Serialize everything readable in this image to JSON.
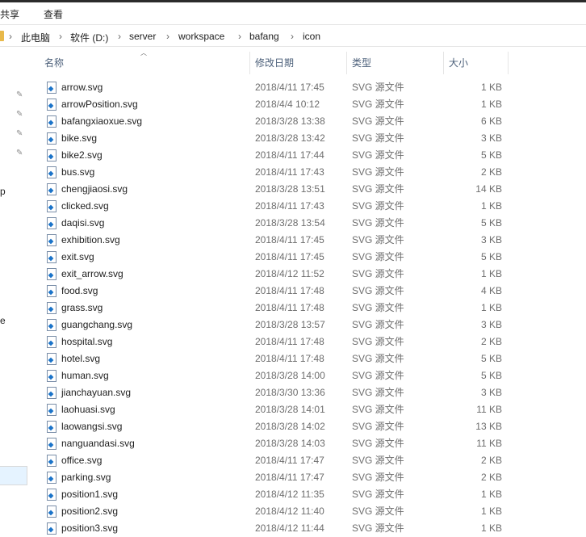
{
  "ribbon": {
    "tabs": [
      "共享",
      "查看"
    ]
  },
  "address": {
    "crumbs": [
      "此电脑",
      "软件 (D:)",
      "server",
      "workspace",
      "bafang",
      "icon"
    ]
  },
  "nav": {
    "fragments": [
      "p",
      "e"
    ]
  },
  "columns": {
    "name": "名称",
    "date": "修改日期",
    "type": "类型",
    "size": "大小"
  },
  "files": [
    {
      "name": "arrow.svg",
      "date": "2018/4/11 17:45",
      "type": "SVG 源文件",
      "size": "1 KB"
    },
    {
      "name": "arrowPosition.svg",
      "date": "2018/4/4 10:12",
      "type": "SVG 源文件",
      "size": "1 KB"
    },
    {
      "name": "bafangxiaoxue.svg",
      "date": "2018/3/28 13:38",
      "type": "SVG 源文件",
      "size": "6 KB"
    },
    {
      "name": "bike.svg",
      "date": "2018/3/28 13:42",
      "type": "SVG 源文件",
      "size": "3 KB"
    },
    {
      "name": "bike2.svg",
      "date": "2018/4/11 17:44",
      "type": "SVG 源文件",
      "size": "5 KB"
    },
    {
      "name": "bus.svg",
      "date": "2018/4/11 17:43",
      "type": "SVG 源文件",
      "size": "2 KB"
    },
    {
      "name": "chengjiaosi.svg",
      "date": "2018/3/28 13:51",
      "type": "SVG 源文件",
      "size": "14 KB"
    },
    {
      "name": "clicked.svg",
      "date": "2018/4/11 17:43",
      "type": "SVG 源文件",
      "size": "1 KB"
    },
    {
      "name": "daqisi.svg",
      "date": "2018/3/28 13:54",
      "type": "SVG 源文件",
      "size": "5 KB"
    },
    {
      "name": "exhibition.svg",
      "date": "2018/4/11 17:45",
      "type": "SVG 源文件",
      "size": "3 KB"
    },
    {
      "name": "exit.svg",
      "date": "2018/4/11 17:45",
      "type": "SVG 源文件",
      "size": "5 KB"
    },
    {
      "name": "exit_arrow.svg",
      "date": "2018/4/12 11:52",
      "type": "SVG 源文件",
      "size": "1 KB"
    },
    {
      "name": "food.svg",
      "date": "2018/4/11 17:48",
      "type": "SVG 源文件",
      "size": "4 KB"
    },
    {
      "name": "grass.svg",
      "date": "2018/4/11 17:48",
      "type": "SVG 源文件",
      "size": "1 KB"
    },
    {
      "name": "guangchang.svg",
      "date": "2018/3/28 13:57",
      "type": "SVG 源文件",
      "size": "3 KB"
    },
    {
      "name": "hospital.svg",
      "date": "2018/4/11 17:48",
      "type": "SVG 源文件",
      "size": "2 KB"
    },
    {
      "name": "hotel.svg",
      "date": "2018/4/11 17:48",
      "type": "SVG 源文件",
      "size": "5 KB"
    },
    {
      "name": "human.svg",
      "date": "2018/3/28 14:00",
      "type": "SVG 源文件",
      "size": "5 KB"
    },
    {
      "name": "jianchayuan.svg",
      "date": "2018/3/30 13:36",
      "type": "SVG 源文件",
      "size": "3 KB"
    },
    {
      "name": "laohuasi.svg",
      "date": "2018/3/28 14:01",
      "type": "SVG 源文件",
      "size": "11 KB"
    },
    {
      "name": "laowangsi.svg",
      "date": "2018/3/28 14:02",
      "type": "SVG 源文件",
      "size": "13 KB"
    },
    {
      "name": "nanguandasi.svg",
      "date": "2018/3/28 14:03",
      "type": "SVG 源文件",
      "size": "11 KB"
    },
    {
      "name": "office.svg",
      "date": "2018/4/11 17:47",
      "type": "SVG 源文件",
      "size": "2 KB"
    },
    {
      "name": "parking.svg",
      "date": "2018/4/11 17:47",
      "type": "SVG 源文件",
      "size": "2 KB"
    },
    {
      "name": "position1.svg",
      "date": "2018/4/12 11:35",
      "type": "SVG 源文件",
      "size": "1 KB"
    },
    {
      "name": "position2.svg",
      "date": "2018/4/12 11:40",
      "type": "SVG 源文件",
      "size": "1 KB"
    },
    {
      "name": "position3.svg",
      "date": "2018/4/12 11:44",
      "type": "SVG 源文件",
      "size": "1 KB"
    }
  ]
}
